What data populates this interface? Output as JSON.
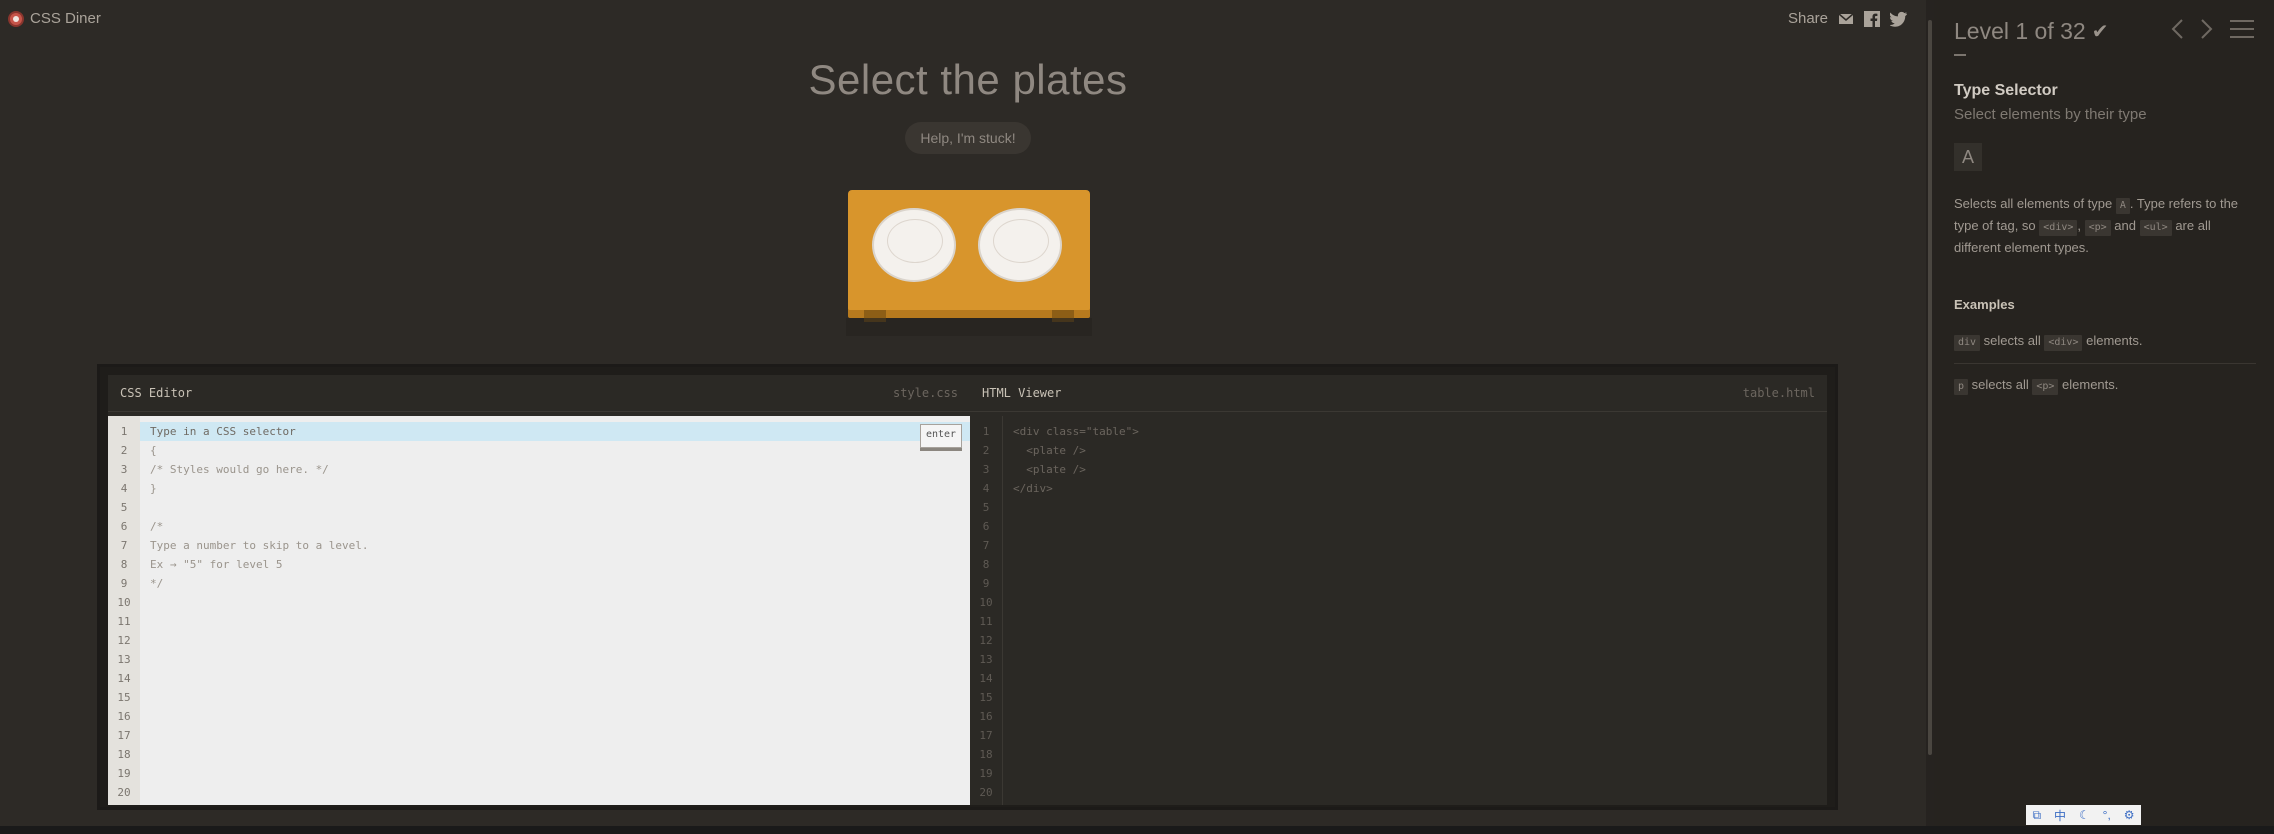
{
  "app": {
    "title": "CSS Diner"
  },
  "share": {
    "label": "Share",
    "icons": [
      "mail-icon",
      "facebook-icon",
      "twitter-icon"
    ]
  },
  "level": {
    "instruction": "Select the plates",
    "help_label": "Help, I'm stuck!"
  },
  "editor": {
    "css": {
      "title": "CSS Editor",
      "file": "style.css",
      "placeholder": "Type in a CSS selector",
      "enter_label": "enter",
      "lines": [
        "Type in a CSS selector",
        "{",
        "/* Styles would go here. */",
        "}",
        "",
        "/*",
        "Type a number to skip to a level.",
        "Ex → \"5\" for level 5",
        "*/",
        "",
        "",
        "",
        "",
        "",
        "",
        "",
        "",
        "",
        "",
        ""
      ],
      "line_numbers": [
        "1",
        "2",
        "3",
        "4",
        "5",
        "6",
        "7",
        "8",
        "9",
        "10",
        "11",
        "12",
        "13",
        "14",
        "15",
        "16",
        "17",
        "18",
        "19",
        "20"
      ]
    },
    "html": {
      "title": "HTML Viewer",
      "file": "table.html",
      "lines": [
        "<div class=\"table\">",
        "  <plate />",
        "  <plate />",
        "</div>",
        "",
        "",
        "",
        "",
        "",
        "",
        "",
        "",
        "",
        "",
        "",
        "",
        "",
        "",
        "",
        ""
      ],
      "line_numbers": [
        "1",
        "2",
        "3",
        "4",
        "5",
        "6",
        "7",
        "8",
        "9",
        "10",
        "11",
        "12",
        "13",
        "14",
        "15",
        "16",
        "17",
        "18",
        "19",
        "20"
      ]
    }
  },
  "sidebar": {
    "level_label": "Level 1 of 32",
    "check": "✔",
    "selector_name": "Type Selector",
    "subtitle": "Select elements by their type",
    "syntax": "A",
    "desc": {
      "p1": "Selects all elements of type ",
      "t1": "A",
      "p2": ". Type refers to the type of tag, so ",
      "t2": "<div>",
      "p3": ", ",
      "t3": "<p>",
      "p4": " and ",
      "t4": "<ul>",
      "p5": " are all different element types."
    },
    "examples_heading": "Examples",
    "examples": [
      {
        "code": "div",
        "mid": " selects all ",
        "tag": "<div>",
        "end": " elements."
      },
      {
        "code": "p",
        "mid": " selects all ",
        "tag": "<p>",
        "end": " elements."
      }
    ]
  },
  "ime": {
    "items": [
      "⧉",
      "中",
      "☾",
      "°,",
      "⚙"
    ]
  }
}
